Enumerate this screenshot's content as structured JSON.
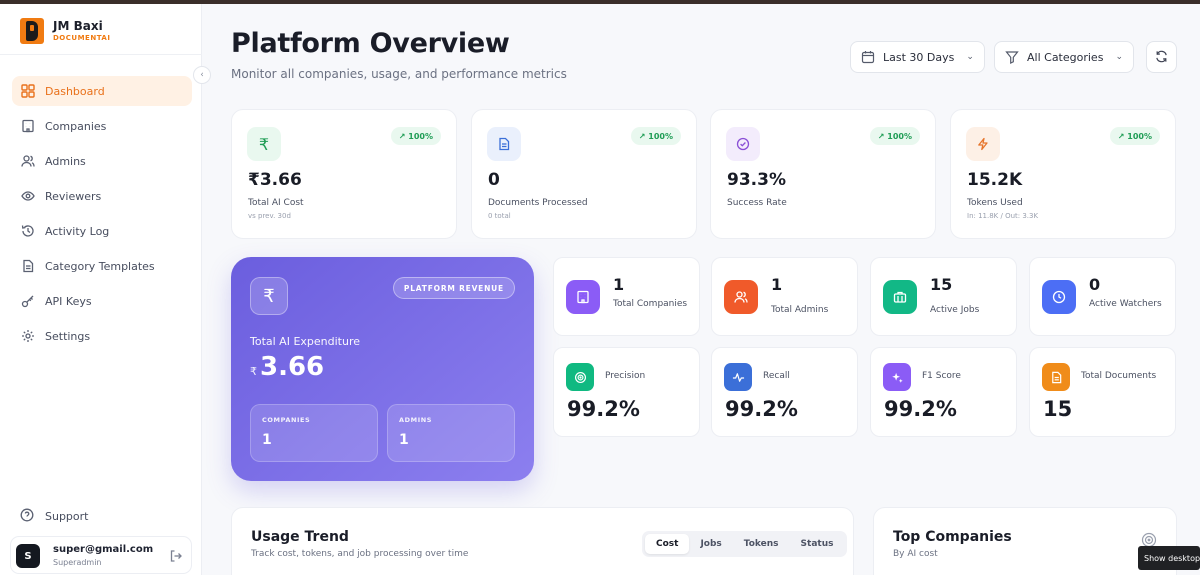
{
  "brand": {
    "name": "JM Baxi",
    "sub": "DOCUMENTAI"
  },
  "sidebar": {
    "items": [
      {
        "label": "Dashboard",
        "icon": "grid-icon",
        "active": true
      },
      {
        "label": "Companies",
        "icon": "building-icon"
      },
      {
        "label": "Admins",
        "icon": "users-icon"
      },
      {
        "label": "Reviewers",
        "icon": "eye-icon"
      },
      {
        "label": "Activity Log",
        "icon": "history-icon"
      },
      {
        "label": "Category Templates",
        "icon": "document-icon"
      },
      {
        "label": "API Keys",
        "icon": "key-icon"
      },
      {
        "label": "Settings",
        "icon": "gear-icon"
      }
    ],
    "support_label": "Support",
    "user": {
      "initial": "S",
      "email": "super@gmail.com",
      "role": "Superadmin"
    }
  },
  "header": {
    "title": "Platform Overview",
    "subtitle": "Monitor all companies, usage, and performance metrics",
    "date_filter": "Last 30 Days",
    "category_filter": "All Categories"
  },
  "stats": [
    {
      "icon": "rupee-icon",
      "badge": "↗ 100%",
      "value": "₹3.66",
      "label": "Total AI Cost",
      "note": "vs prev. 30d",
      "color": "#1f9d55",
      "bg": "#e9f8ef"
    },
    {
      "icon": "file-icon",
      "badge": "↗ 100%",
      "value": "0",
      "label": "Documents Processed",
      "note": "0 total",
      "color": "#3b6fd8",
      "bg": "#eaf0fc"
    },
    {
      "icon": "check-circle-icon",
      "badge": "↗ 100%",
      "value": "93.3%",
      "label": "Success Rate",
      "note": "",
      "color": "#8a4fd6",
      "bg": "#f3ecfc"
    },
    {
      "icon": "bolt-icon",
      "badge": "↗ 100%",
      "value": "15.2K",
      "label": "Tokens Used",
      "note": "In: 11.8K / Out: 3.3K",
      "color": "#e6742a",
      "bg": "#fdf0e6"
    }
  ],
  "revenue": {
    "badge": "PLATFORM REVENUE",
    "label": "Total AI Expenditure",
    "currency": "₹",
    "value": "3.66",
    "companies_label": "COMPANIES",
    "companies_value": "1",
    "admins_label": "ADMINS",
    "admins_value": "1"
  },
  "counts": [
    {
      "value": "1",
      "label": "Total Companies",
      "icon": "building-icon",
      "color": "#8b5cf6"
    },
    {
      "value": "1",
      "label": "Total Admins",
      "icon": "users-icon",
      "color": "#f05a2a"
    },
    {
      "value": "15",
      "label": "Active Jobs",
      "icon": "briefcase-icon",
      "color": "#12b886"
    },
    {
      "value": "0",
      "label": "Active Watchers",
      "icon": "clock-icon",
      "color": "#4c6ef5"
    }
  ],
  "metrics": [
    {
      "label": "Precision",
      "value": "99.2%",
      "icon": "target-icon",
      "color": "#10b981"
    },
    {
      "label": "Recall",
      "value": "99.2%",
      "icon": "pulse-icon",
      "color": "#3b6fd8"
    },
    {
      "label": "F1 Score",
      "value": "99.2%",
      "icon": "sparkle-icon",
      "color": "#8b5cf6"
    },
    {
      "label": "Total Documents",
      "value": "15",
      "icon": "file-icon",
      "color": "#f08c1a"
    }
  ],
  "usage": {
    "title": "Usage Trend",
    "subtitle": "Track cost, tokens, and job processing over time",
    "tabs": [
      "Cost",
      "Jobs",
      "Tokens",
      "Status"
    ]
  },
  "top_companies": {
    "title": "Top Companies",
    "subtitle": "By AI cost"
  },
  "tooltip": "Show desktop"
}
